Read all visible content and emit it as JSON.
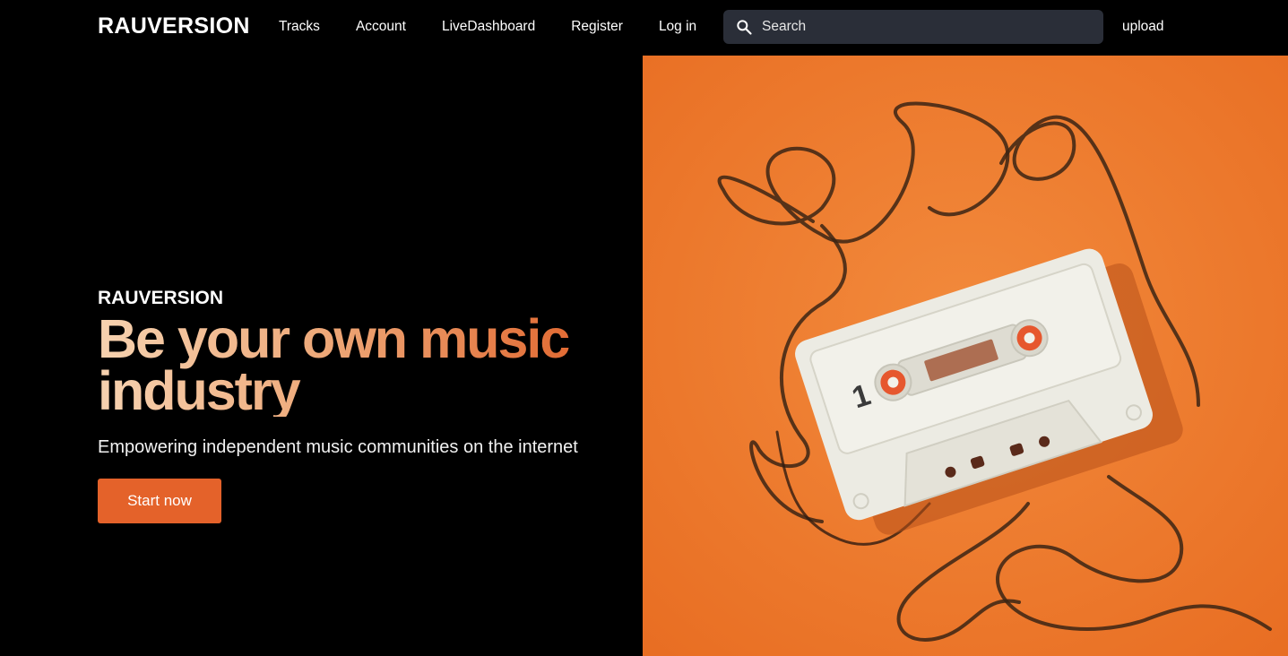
{
  "nav": {
    "logo": "RAUVERSION",
    "links": [
      {
        "label": "Tracks"
      },
      {
        "label": "Account"
      },
      {
        "label": "LiveDashboard"
      },
      {
        "label": "Register"
      },
      {
        "label": "Log in"
      }
    ],
    "search": {
      "placeholder": "Search",
      "icon": "search-icon"
    },
    "upload_label": "upload"
  },
  "hero": {
    "eyebrow": "RAUVERSION",
    "headline": "Be your own music industry",
    "subtitle": "Empowering independent music communities on the internet",
    "cta_label": "Start now",
    "image": {
      "subject": "cassette tape on orange background",
      "cassette_label": "1",
      "background_color": "#ec7a2e"
    }
  },
  "colors": {
    "background": "#000000",
    "accent": "#e4622a",
    "search_bg": "#2a2e38"
  }
}
